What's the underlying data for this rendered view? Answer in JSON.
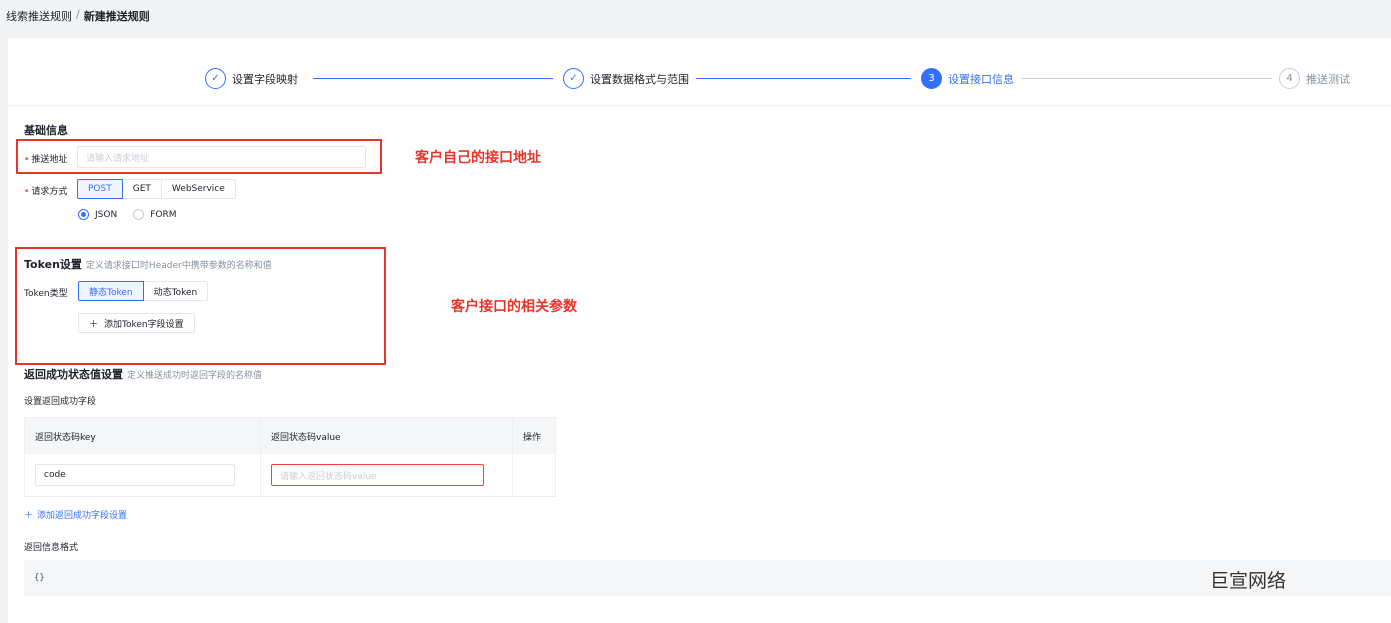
{
  "breadcrumb": {
    "parent": "线索推送规则",
    "separator": "/",
    "current": "新建推送规则"
  },
  "steps": [
    {
      "number": "✓",
      "label": "设置字段映射",
      "status": "done"
    },
    {
      "number": "✓",
      "label": "设置数据格式与范围",
      "status": "done"
    },
    {
      "number": "3",
      "label": "设置接口信息",
      "status": "active"
    },
    {
      "number": "4",
      "label": "推送测试",
      "status": "pending"
    }
  ],
  "basic": {
    "title": "基础信息",
    "url_label": "推送地址",
    "url_placeholder": "请输入请求地址",
    "method_label": "请求方式",
    "methods": [
      "POST",
      "GET",
      "WebService"
    ],
    "formats": [
      "JSON",
      "FORM"
    ]
  },
  "token": {
    "title": "Token设置",
    "subtitle": "定义请求接口时Header中携带参数的名称和值",
    "type_label": "Token类型",
    "types": [
      "静态Token",
      "动态Token"
    ],
    "add_label": "添加Token字段设置"
  },
  "success": {
    "title": "返回成功状态值设置",
    "subtitle": "定义推送成功时返回字段的名称值",
    "field_label": "设置返回成功字段",
    "columns": [
      "返回状态码key",
      "返回状态码value",
      "操作"
    ],
    "row_key": "code",
    "row_value_placeholder": "请输入返回状态码value",
    "add_link": "添加返回成功字段设置",
    "format_label": "返回信息格式",
    "format_value": "{}"
  },
  "annotations": {
    "url_note": "客户自己的接口地址",
    "token_note": "客户接口的相关参数"
  },
  "watermark": "巨宣网络",
  "colors": {
    "primary": "#3370ff",
    "annotation": "#e8352a"
  }
}
